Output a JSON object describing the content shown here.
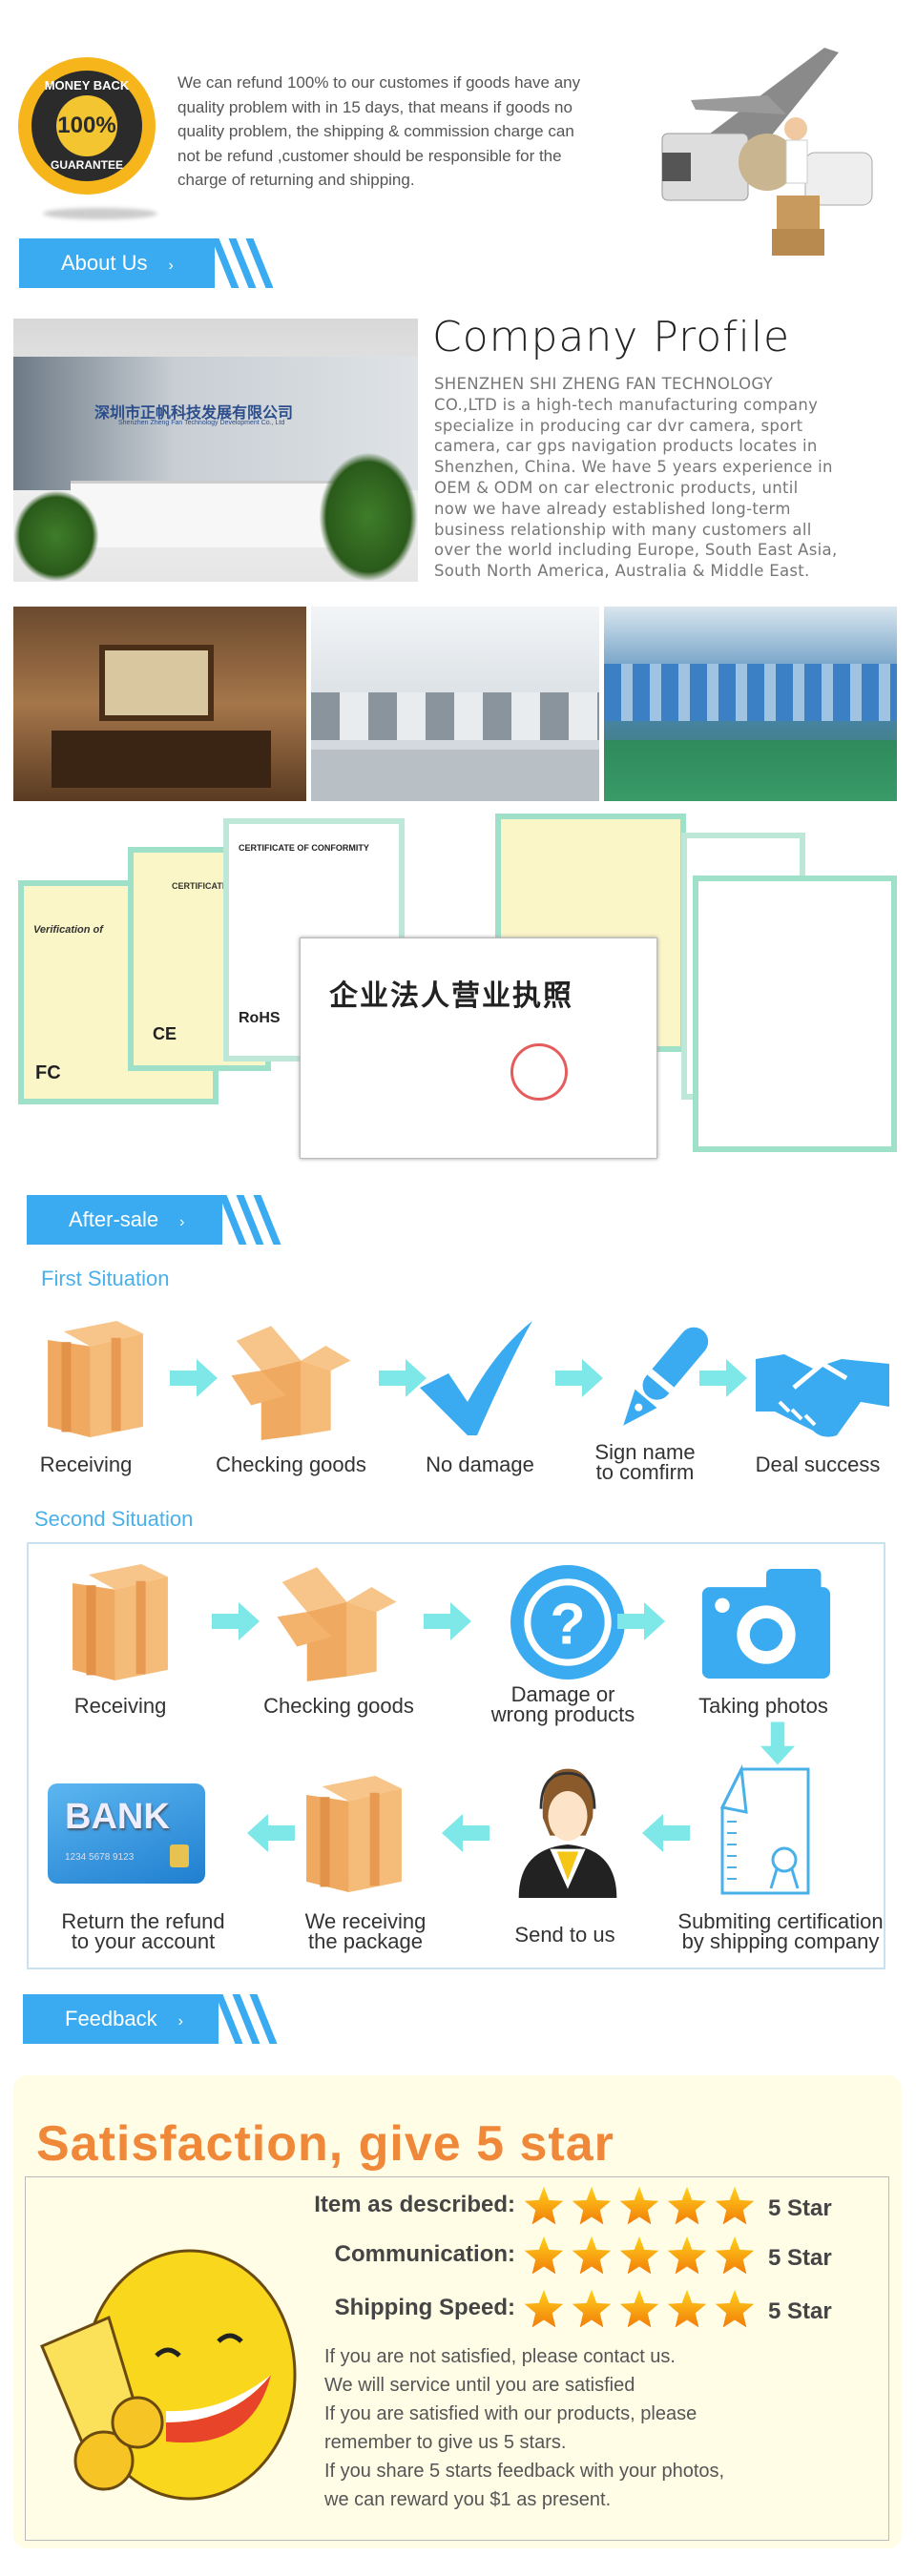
{
  "guarantee": {
    "badge_text": [
      "MONEY BACK",
      "100%",
      "GUARANTEE"
    ],
    "lines": [
      "We can refund 100% to our customes if goods have any",
      "quality problem with in 15 days, that means if goods no",
      "quality problem, the shipping & commission charge can",
      "not be refund ,customer should be responsible  for the",
      "charge of returning and shipping."
    ]
  },
  "sections": {
    "about": {
      "label": "About Us",
      "chevron": "›"
    },
    "aftersale": {
      "label": "After-sale",
      "chevron": "›"
    },
    "feedback": {
      "label": "Feedback",
      "chevron": "›"
    }
  },
  "company": {
    "sign_text": "深圳市正帆科技发展有限公司",
    "sign_sub": "Shenzhen Zheng Fan Technology Development Co., Ltd",
    "title": "Company Profile",
    "lines": [
      "SHENZHEN  SHI  ZHENG FAN  TECHNOLOGY",
      "CO.,LTD is a high-tech manufacturing company",
      "specialize in producing car dvr camera, sport",
      "camera, car gps navigation products locates in",
      "Shenzhen, China. We have 5 years experience in",
      "OEM & ODM on car electronic products, until",
      "now we have already established long-term",
      "business relationship with many customers all",
      "over the world including Europe, South East Asia,",
      "South North America, Australia & Middle East."
    ]
  },
  "certificates": {
    "titles": [
      "Verification of",
      "CERTIFICATE",
      "CERTIFICATE OF CONFORMITY",
      "企业法人营业执照",
      "RoHS",
      "FC",
      "CE"
    ]
  },
  "aftersale": {
    "first_title": "First Situation",
    "first_steps": [
      {
        "label": "Receiving",
        "icon": "closed-box-icon"
      },
      {
        "label": "Checking goods",
        "icon": "open-box-icon"
      },
      {
        "label": "No damage",
        "icon": "checkmark-icon"
      },
      {
        "label": "Sign name\nto comfirm",
        "icon": "pen-icon"
      },
      {
        "label": "Deal success",
        "icon": "handshake-icon"
      }
    ],
    "second_title": "Second Situation",
    "second_row1": [
      {
        "label": "Receiving",
        "icon": "closed-box-icon"
      },
      {
        "label": "Checking goods",
        "icon": "open-box-icon"
      },
      {
        "label": "Damage or\nwrong products",
        "icon": "question-icon"
      },
      {
        "label": "Taking photos",
        "icon": "camera-icon"
      }
    ],
    "second_row2": [
      {
        "label": "Return the refund\nto your account",
        "icon": "bank-card-icon"
      },
      {
        "label": "We receiving\nthe package",
        "icon": "closed-box-icon"
      },
      {
        "label": "Send to us",
        "icon": "support-agent-icon"
      },
      {
        "label": "Submiting certification\nby shipping company",
        "icon": "certificate-document-icon"
      }
    ],
    "bank_card": {
      "brand": "BANK",
      "number": "1234 5678 9123"
    }
  },
  "feedback": {
    "heading": "Satisfaction, give 5 star",
    "ratings": [
      {
        "label": "Item as described:",
        "stars": 5,
        "value": "5 Star"
      },
      {
        "label": "Communication:",
        "stars": 5,
        "value": "5 Star"
      },
      {
        "label": "Shipping Speed:",
        "stars": 5,
        "value": "5 Star"
      }
    ],
    "lines": [
      "If you are not satisfied, please contact us.",
      "We will service until you are satisfied",
      "If you are satisfied with our products, please",
      "remember to give us 5 stars.",
      "If you share 5 starts feedback with your photos,",
      "we can reward you $1 as present."
    ]
  },
  "colors": {
    "accent": "#3aabf0",
    "arrow": "#7ee8e8",
    "heading_orange": "#f0883a",
    "card_bg": "#fffde6",
    "box": "#f2b56f"
  }
}
